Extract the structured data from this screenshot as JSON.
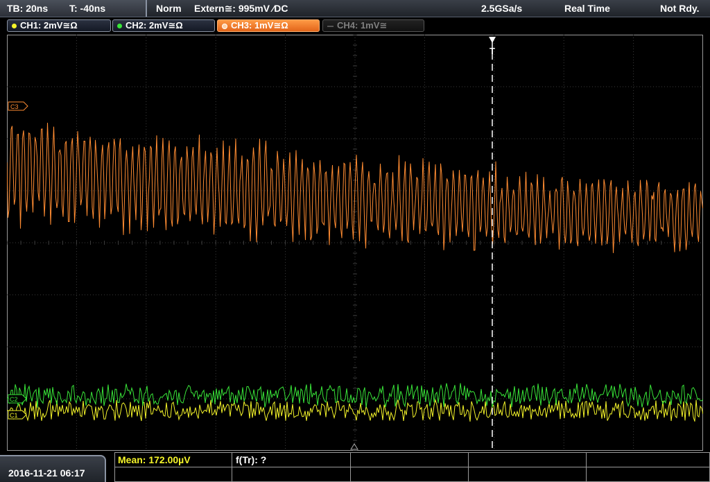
{
  "topbar": {
    "timebase": "TB: 20ns",
    "trigger_time": "T: -40ns",
    "mode": "Norm",
    "trigger_source": "Extern≅: 995mV ⁄DC",
    "sample_rate": "2.5GSa/s",
    "acq_mode": "Real Time",
    "status": "Not Rdy."
  },
  "channels": [
    {
      "label": "CH1: 2mV≅Ω",
      "color": "#f5f52a",
      "state": "on"
    },
    {
      "label": "CH2: 2mV≅Ω",
      "color": "#39e639",
      "state": "on"
    },
    {
      "label": "CH3: 1mV≅Ω",
      "color": "#ff8c32",
      "state": "active"
    },
    {
      "label": "CH4: 1mV≅",
      "color": "#808080",
      "state": "off"
    }
  ],
  "markers": {
    "c3": "C3",
    "c2": "C2",
    "c1": "C1",
    "trigger": "T"
  },
  "bottom": {
    "datetime": "2016-11-21 06:17",
    "mean_label": "Mean: 172.00µV",
    "freq_label": "f(Tr): ?"
  },
  "colors": {
    "ch1": "#f5f52a",
    "ch2": "#39e639",
    "ch3": "#ff8c32",
    "grid": "#3c3c3c",
    "frame": "#9a9a9a"
  }
}
